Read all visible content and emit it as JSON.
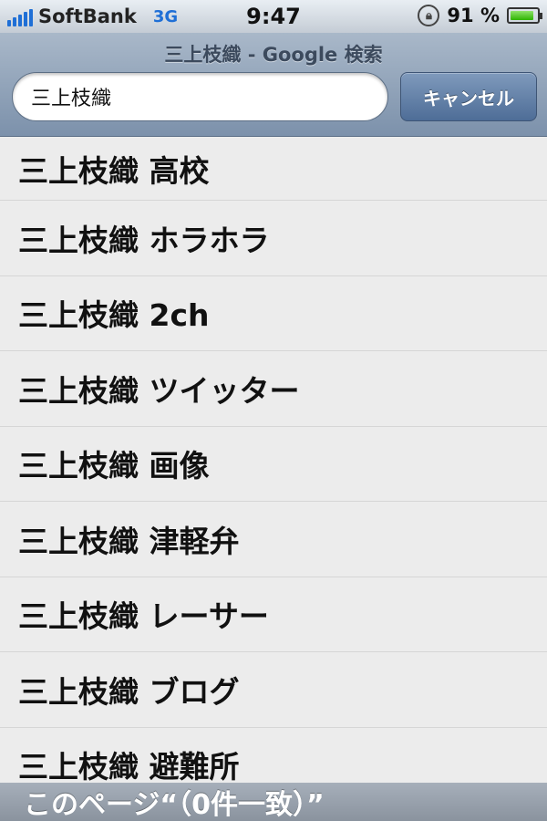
{
  "status_bar": {
    "carrier": "SoftBank",
    "network": "3G",
    "time": "9:47",
    "battery_percent": "91 %",
    "battery_level": 0.91
  },
  "header": {
    "page_title": "三上枝織 - Google 検索",
    "search_value": "三上枝織",
    "cancel_label": "キャンセル"
  },
  "suggestions": [
    "三上枝織 高校",
    "三上枝織 ホラホラ",
    "三上枝織 2ch",
    "三上枝織 ツイッター",
    "三上枝織 画像",
    "三上枝織 津軽弁",
    "三上枝織 レーサー",
    "三上枝織 ブログ",
    "三上枝織 避難所"
  ],
  "footer": {
    "find_on_page": "このページ“（0件一致）”"
  },
  "colors": {
    "accent": "#1f6fd6",
    "header_top": "#a9b8c9",
    "header_bottom": "#7c91ab",
    "cancel_button": "#4e6d97"
  }
}
